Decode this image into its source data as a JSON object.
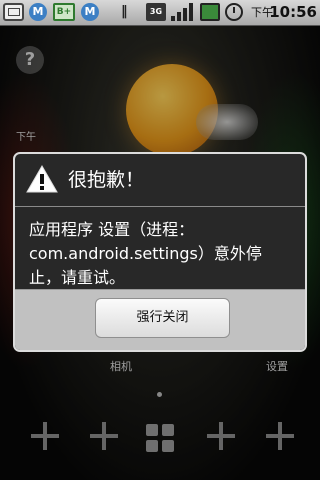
{
  "status_bar": {
    "icons": {
      "messaging": "message-icon",
      "m_badge_1": "M",
      "battery_saver": "B+",
      "m_badge_2": "M",
      "vibrate": "vibrate-icon",
      "network": "3G",
      "signal": "signal-icon",
      "battery": "battery-icon",
      "alarm": "alarm-icon"
    },
    "am_pm": "下午",
    "time": "10:56"
  },
  "home": {
    "help_glyph": "?",
    "clock_am_pm": "下午",
    "shortcut_labels": {
      "camera": "相机",
      "settings": "设置"
    }
  },
  "dialog": {
    "icon": "warning-icon",
    "title": "很抱歉！",
    "message": "应用程序 设置（进程：com.android.settings）意外停止，请重试。",
    "force_close_label": "强行关闭"
  },
  "colors": {
    "dialog_background": "#282828",
    "dialog_border": "#dcdcdc",
    "button_bar": "#c1c1c1",
    "warning_fill": "#ffffff"
  }
}
